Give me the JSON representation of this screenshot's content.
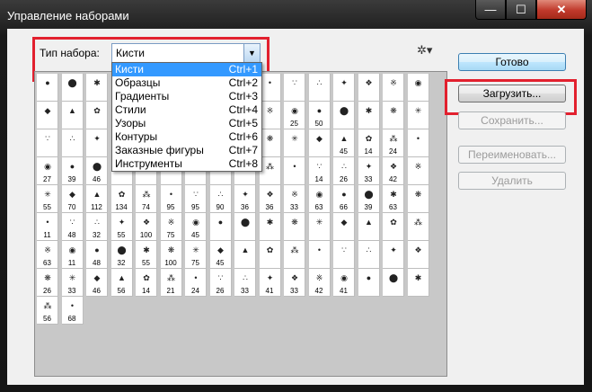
{
  "window": {
    "title": "Управление наборами",
    "minimize": "—",
    "maximize": "☐",
    "close": "✕"
  },
  "preset_type": {
    "label": "Тип набора:",
    "value": "Кисти",
    "arrow": "▼"
  },
  "dropdown": [
    {
      "label": "Кисти",
      "shortcut": "Ctrl+1",
      "selected": true
    },
    {
      "label": "Образцы",
      "shortcut": "Ctrl+2"
    },
    {
      "label": "Градиенты",
      "shortcut": "Ctrl+3"
    },
    {
      "label": "Стили",
      "shortcut": "Ctrl+4"
    },
    {
      "label": "Узоры",
      "shortcut": "Ctrl+5"
    },
    {
      "label": "Контуры",
      "shortcut": "Ctrl+6"
    },
    {
      "label": "Заказные фигуры",
      "shortcut": "Ctrl+7"
    },
    {
      "label": "Инструменты",
      "shortcut": "Ctrl+8"
    }
  ],
  "gear_icon": "✲▾",
  "buttons": {
    "done": "Готово",
    "load": "Загрузить...",
    "save": "Сохранить...",
    "rename": "Переименовать...",
    "delete": "Удалить"
  },
  "brush_rows": [
    [
      "",
      "",
      "",
      "",
      "",
      "",
      "",
      "",
      "",
      "",
      "",
      "",
      "",
      "",
      "",
      ""
    ],
    [
      "",
      "",
      "",
      "",
      "",
      "",
      "",
      "",
      "",
      "",
      "25",
      "50",
      "",
      "",
      "",
      ""
    ],
    [
      "",
      "",
      "",
      "",
      "",
      "",
      "",
      "",
      "",
      "",
      "",
      "",
      "45",
      "14",
      "24",
      ""
    ],
    [
      "27",
      "39",
      "46",
      "",
      "",
      "",
      "",
      "",
      "",
      "",
      "",
      "14",
      "26",
      "33",
      "42",
      ""
    ],
    [
      "55",
      "70",
      "112",
      "134",
      "74",
      "95",
      "95",
      "90",
      "36",
      "36",
      "33",
      "63",
      "66",
      "39",
      "63",
      ""
    ],
    [
      "11",
      "48",
      "32",
      "55",
      "100",
      "75",
      "45",
      "",
      "",
      "",
      "",
      "",
      "",
      "",
      "",
      ""
    ],
    [
      "63",
      "11",
      "48",
      "32",
      "55",
      "100",
      "75",
      "45",
      "",
      "",
      "",
      "",
      "",
      "",
      "",
      ""
    ],
    [
      "26",
      "33",
      "46",
      "56",
      "14",
      "21",
      "24",
      "26",
      "33",
      "41",
      "33",
      "42",
      "41",
      "",
      "",
      ""
    ],
    [
      "56",
      "68"
    ]
  ]
}
